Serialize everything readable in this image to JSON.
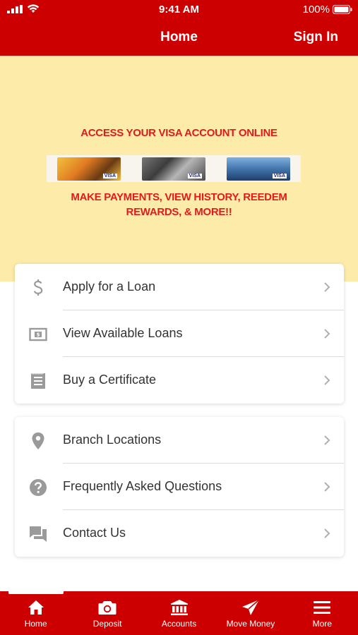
{
  "status_bar": {
    "time": "9:41 AM",
    "battery": "100%"
  },
  "nav": {
    "title": "Home",
    "sign_in": "Sign In"
  },
  "banner": {
    "line1": "ACCESS YOUR VISA ACCOUNT ONLINE",
    "line2a": "MAKE PAYMENTS, VIEW HISTORY, REEDEM",
    "line2b": "REWARDS, & MORE!!",
    "card_brand": "VISA"
  },
  "menu_group_1": [
    {
      "label": "Apply for a Loan",
      "icon": "dollar-icon"
    },
    {
      "label": "View Available Loans",
      "icon": "bill-icon"
    },
    {
      "label": "Buy a Certificate",
      "icon": "certificate-icon"
    }
  ],
  "menu_group_2": [
    {
      "label": "Branch Locations",
      "icon": "location-pin-icon"
    },
    {
      "label": "Frequently Asked Questions",
      "icon": "help-circle-icon"
    },
    {
      "label": "Contact Us",
      "icon": "chat-icon"
    }
  ],
  "tabs": [
    {
      "label": "Home",
      "icon": "home-icon"
    },
    {
      "label": "Deposit",
      "icon": "camera-icon"
    },
    {
      "label": "Accounts",
      "icon": "bank-icon"
    },
    {
      "label": "Move Money",
      "icon": "send-icon"
    },
    {
      "label": "More",
      "icon": "menu-icon"
    }
  ],
  "colors": {
    "brand_red": "#cc0000",
    "banner_bg": "#fdebaa",
    "banner_text": "#e01b1b",
    "icon_gray": "#9a9a9a"
  }
}
